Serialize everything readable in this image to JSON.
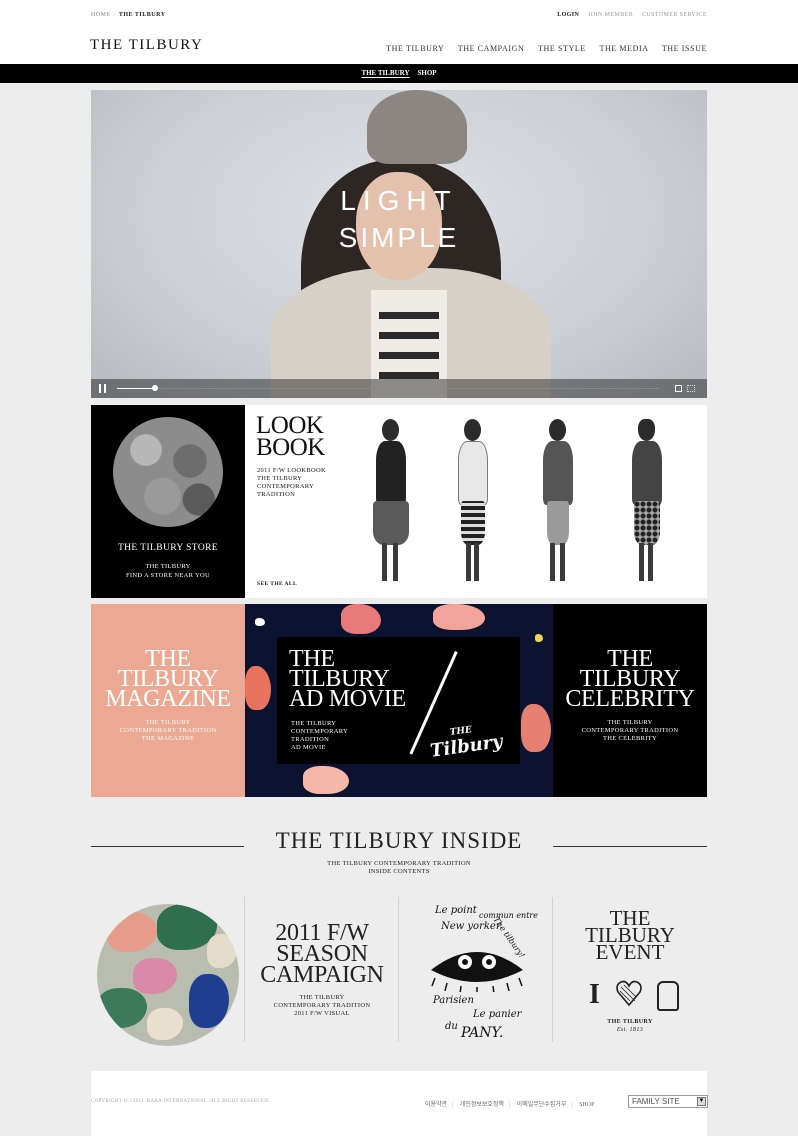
{
  "header": {
    "breadcrumb": [
      "HOME",
      "THE TILBURY"
    ],
    "util": [
      "LOGIN",
      "JOIN MEMBER",
      "CUSTOMER SERVICE"
    ],
    "logo": "THE TILBURY",
    "nav": [
      "THE TILBURY",
      "THE CAMPAIGN",
      "THE STYLE",
      "THE MEDIA",
      "THE ISSUE"
    ],
    "subnav": [
      "THE TILBURY",
      "SHOP"
    ]
  },
  "hero": {
    "line1": "LIGHT",
    "line2": "SIMPLE",
    "progress": 0.07
  },
  "store": {
    "title": "THE TILBURY STORE",
    "sub1": "THE TILBURY",
    "sub2": "FIND A STORE NEAR YOU"
  },
  "lookbook": {
    "title1": "LOOK",
    "title2": "BOOK",
    "lines": [
      "2011 F/W LOOKBOOK",
      "THE TILBURY",
      "CONTEMPORARY",
      "TRADITION"
    ],
    "more": "SEE THE ALL"
  },
  "magazine": {
    "title": [
      "THE",
      "TILBURY",
      "MAGAZINE"
    ],
    "lines": [
      "THE TILBURY",
      "CONTEMPORARY TRADITION",
      "THE MAGAZINE"
    ]
  },
  "admovie": {
    "title": [
      "THE",
      "TILBURY",
      "AD MOVIE"
    ],
    "lines": [
      "THE TILBURY",
      "CONTEMPORARY",
      "TRADITION",
      "AD MOVIE"
    ],
    "logo": [
      "THE",
      "Tilbury"
    ]
  },
  "celebrity": {
    "title": [
      "THE",
      "TILBURY",
      "CELEBRITY"
    ],
    "lines": [
      "THE TILBURY",
      "CONTEMPORARY TRADITION",
      "THE CELEBRITY"
    ]
  },
  "inside": {
    "title": "THE TILBURY INSIDE",
    "sub1": "THE TILBURY CONTEMPORARY TRADITION",
    "sub2": "INSIDE CONTENTS"
  },
  "season": {
    "title": [
      "2011 F/W",
      "SEASON",
      "CAMPAIGN"
    ],
    "lines": [
      "THE TILBURY",
      "CONTEMPORARY TRADITION",
      "2011 F/W VISUAL"
    ]
  },
  "sketch": {
    "texts": [
      "Le point",
      "commun entre",
      "New yorker",
      "The tilbury!",
      "Parisien",
      "Le panier",
      "du",
      "PANY."
    ]
  },
  "event": {
    "title": [
      "THE",
      "TILBURY",
      "EVENT"
    ],
    "logo": "THE TILBURY",
    "est": "Est. 1813"
  },
  "footer": {
    "copyright": "COPYRIGHT (C) 2011. BARA INTERNATIONAL. ALL RIGHT RESERVED.",
    "links": [
      "이용약관",
      "개인정보보호정책",
      "이메일무단수집거부",
      "SHOP"
    ],
    "family_site": "FAMILY SITE"
  }
}
